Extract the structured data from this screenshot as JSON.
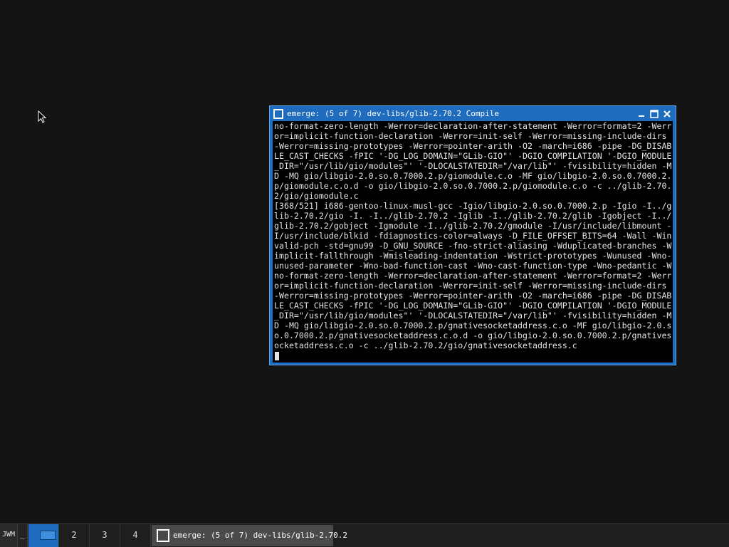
{
  "window": {
    "title": "emerge: (5 of 7) dev-libs/glib-2.70.2 Compile",
    "terminal_lines": [
      "no-format-zero-length -Werror=declaration-after-statement -Werror=format=2 -Werr",
      "or=implicit-function-declaration -Werror=init-self -Werror=missing-include-dirs",
      "-Werror=missing-prototypes -Werror=pointer-arith -O2 -march=i686 -pipe -DG_DISAB",
      "LE_CAST_CHECKS -fPIC '-DG_LOG_DOMAIN=\"GLib-GIO\"' -DGIO_COMPILATION '-DGIO_MODULE",
      "_DIR=\"/usr/lib/gio/modules\"' '-DLOCALSTATEDIR=\"/var/lib\"' -fvisibility=hidden -M",
      "D -MQ gio/libgio-2.0.so.0.7000.2.p/giomodule.c.o -MF gio/libgio-2.0.so.0.7000.2.",
      "p/giomodule.c.o.d -o gio/libgio-2.0.so.0.7000.2.p/giomodule.c.o -c ../glib-2.70.",
      "2/gio/giomodule.c",
      "[368/521] i686-gentoo-linux-musl-gcc -Igio/libgio-2.0.so.0.7000.2.p -Igio -I../g",
      "lib-2.70.2/gio -I. -I../glib-2.70.2 -Iglib -I../glib-2.70.2/glib -Igobject -I../",
      "glib-2.70.2/gobject -Igmodule -I../glib-2.70.2/gmodule -I/usr/include/libmount -",
      "I/usr/include/blkid -fdiagnostics-color=always -D_FILE_OFFSET_BITS=64 -Wall -Win",
      "valid-pch -std=gnu99 -D_GNU_SOURCE -fno-strict-aliasing -Wduplicated-branches -W",
      "implicit-fallthrough -Wmisleading-indentation -Wstrict-prototypes -Wunused -Wno-",
      "unused-parameter -Wno-bad-function-cast -Wno-cast-function-type -Wno-pedantic -W",
      "no-format-zero-length -Werror=declaration-after-statement -Werror=format=2 -Werr",
      "or=implicit-function-declaration -Werror=init-self -Werror=missing-include-dirs",
      "-Werror=missing-prototypes -Werror=pointer-arith -O2 -march=i686 -pipe -DG_DISAB",
      "LE_CAST_CHECKS -fPIC '-DG_LOG_DOMAIN=\"GLib-GIO\"' -DGIO_COMPILATION '-DGIO_MODULE",
      "_DIR=\"/usr/lib/gio/modules\"' '-DLOCALSTATEDIR=\"/var/lib\"' -fvisibility=hidden -M",
      "D -MQ gio/libgio-2.0.so.0.7000.2.p/gnativesocketaddress.c.o -MF gio/libgio-2.0.s",
      "o.0.7000.2.p/gnativesocketaddress.c.o.d -o gio/libgio-2.0.so.0.7000.2.p/gnatives",
      "ocketaddress.c.o -c ../glib-2.70.2/gio/gnativesocketaddress.c"
    ],
    "buttons": {
      "menu_icon": "window-menu-icon",
      "minimize_icon": "minimize-icon",
      "maximize_icon": "maximize-icon",
      "close_icon": "close-icon"
    }
  },
  "taskbar": {
    "menu_label": "JWM",
    "show_desktop_label": "_",
    "workspaces": [
      "",
      "2",
      "3",
      "4"
    ],
    "active_workspace": 1,
    "task_label": "emerge: (5 of 7) dev-libs/glib-2.70.2"
  },
  "colors": {
    "desktop_bg": "#141414",
    "window_border": "#1c6fc2",
    "terminal_bg": "#000000",
    "terminal_fg": "#e4e4e4",
    "taskbar_bg": "#1e1e1e",
    "active_workspace": "#1f6cbf"
  }
}
